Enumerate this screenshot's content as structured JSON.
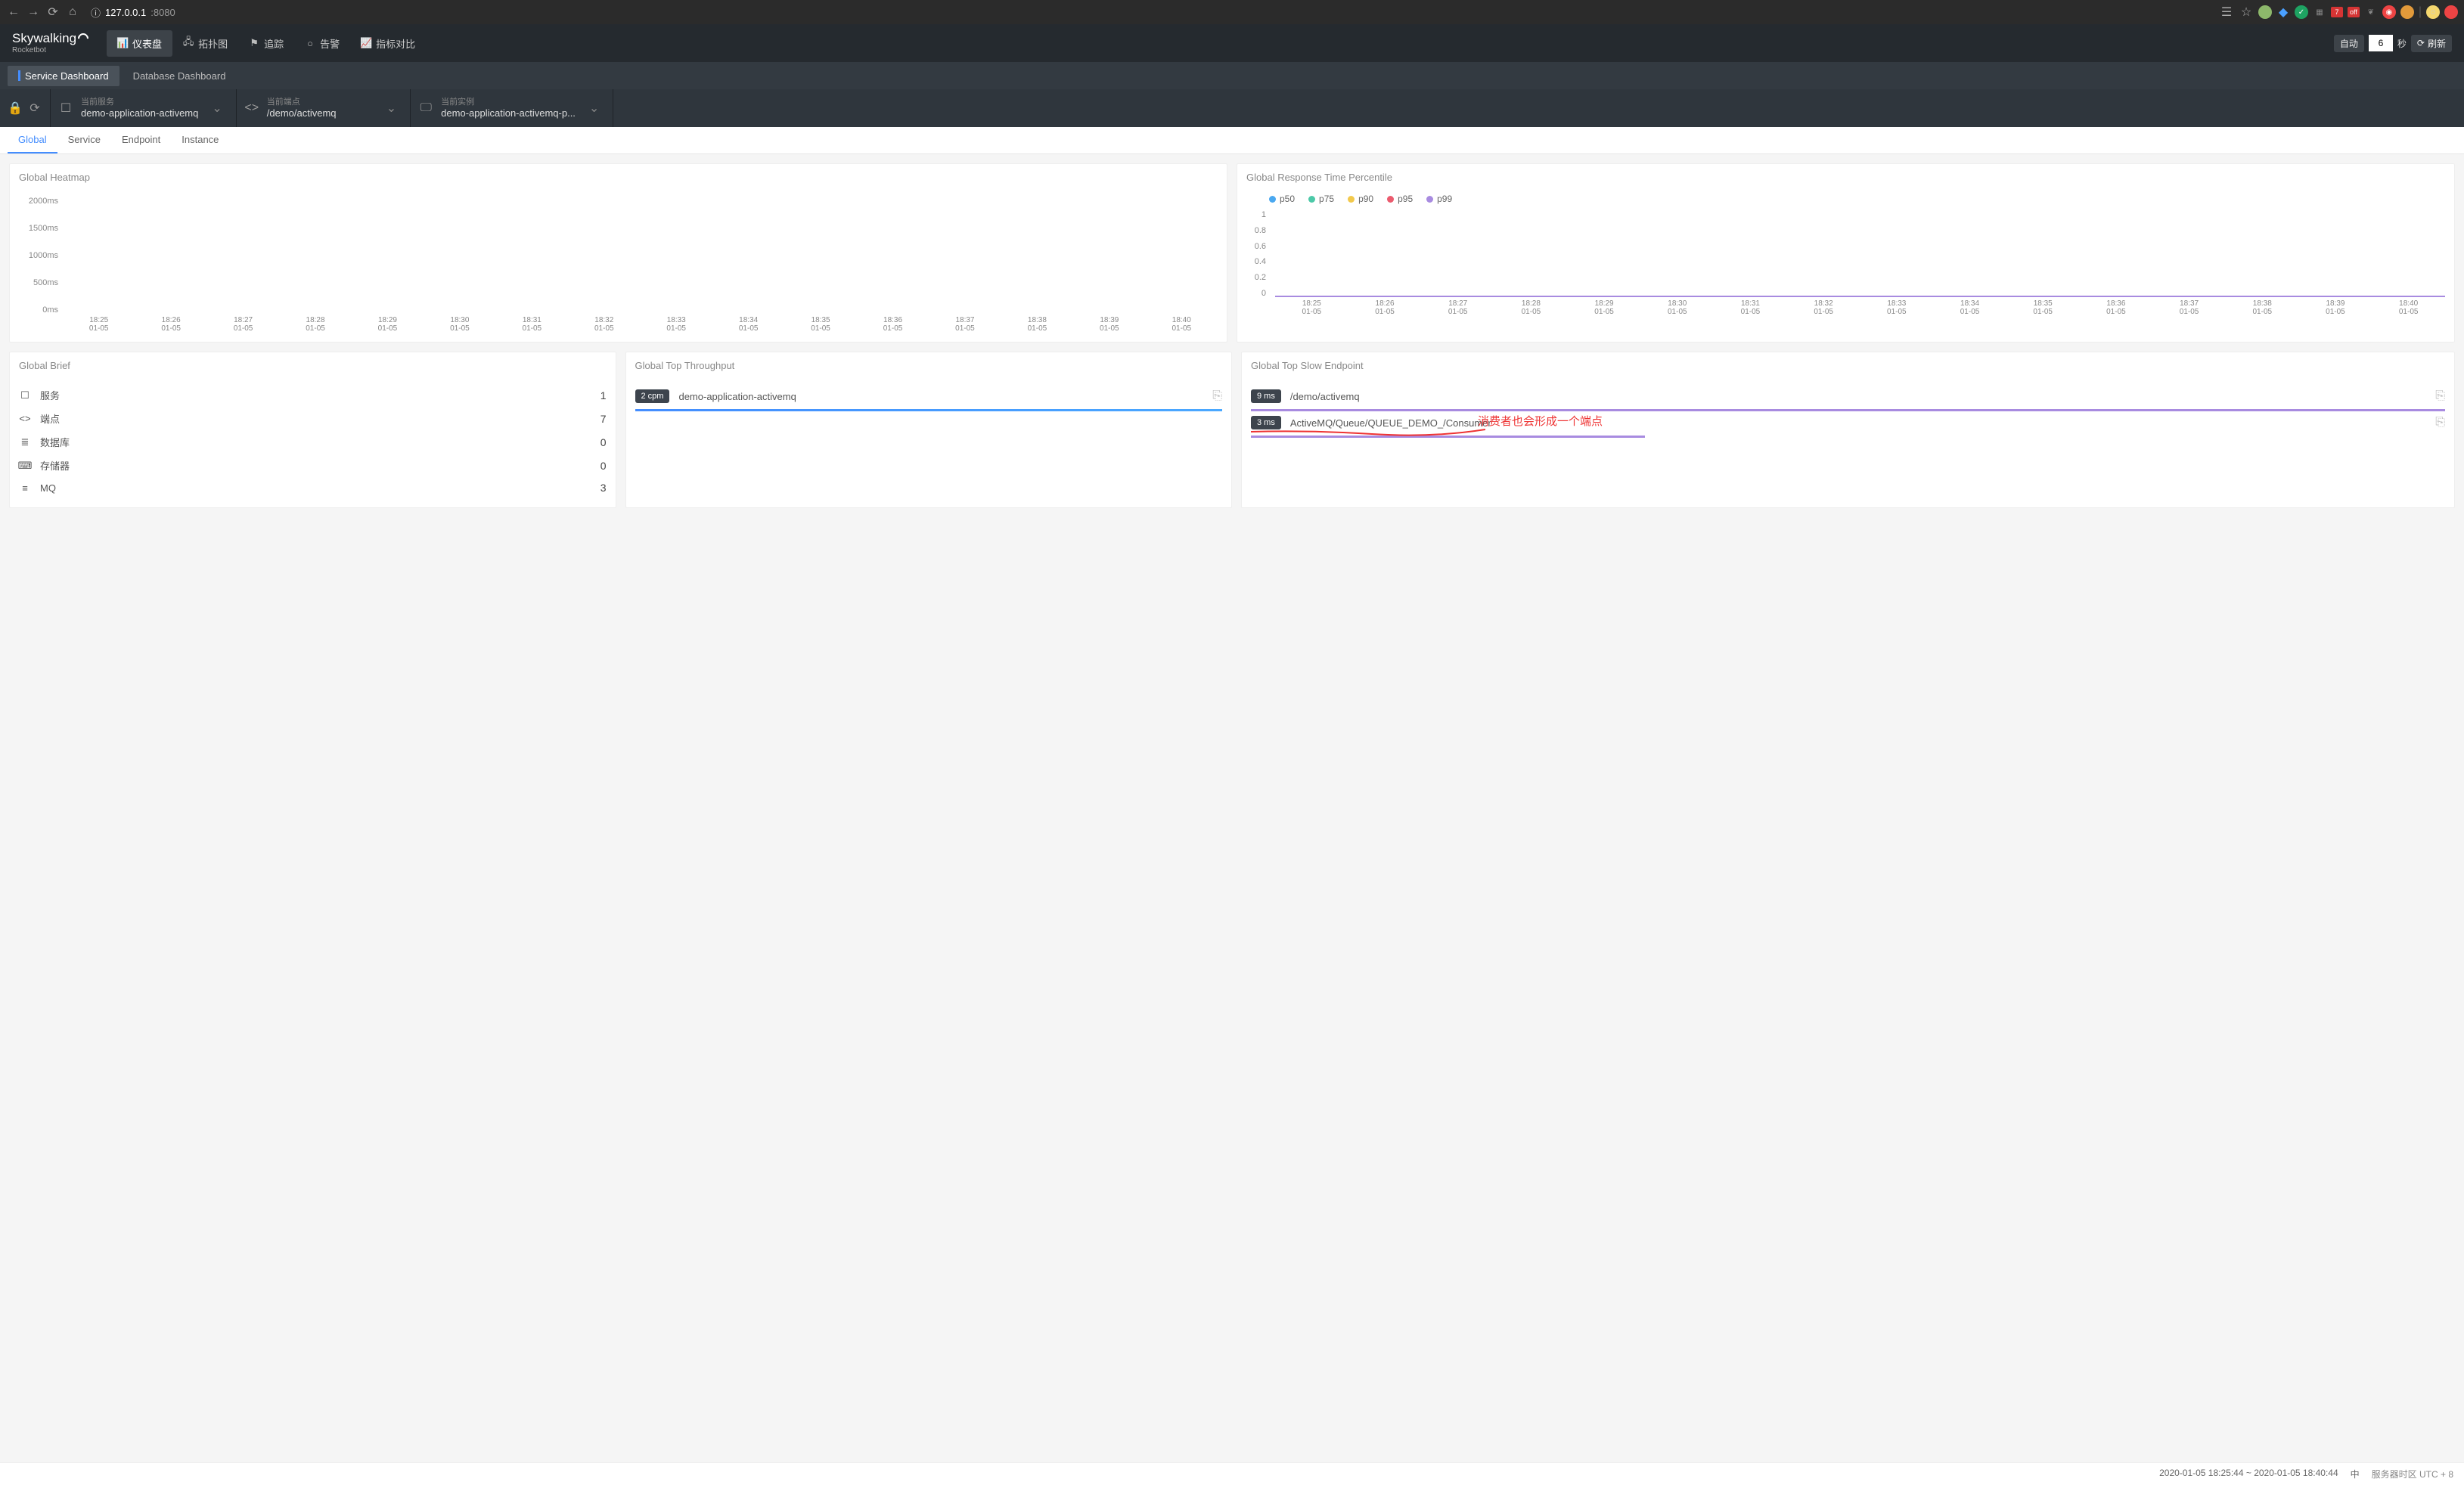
{
  "browser": {
    "url_host": "127.0.0.1",
    "url_port": ":8080",
    "badges": {
      "seven": "7",
      "off": "off"
    }
  },
  "header": {
    "logo_main": "Skywalking",
    "logo_sub": "Rocketbot",
    "nav": [
      {
        "label": "仪表盘"
      },
      {
        "label": "拓扑图"
      },
      {
        "label": "追踪"
      },
      {
        "label": "告警"
      },
      {
        "label": "指标对比"
      }
    ],
    "auto": "自动",
    "interval": "6",
    "unit": "秒",
    "refresh": "刷新"
  },
  "dashboard_tabs": {
    "service": "Service Dashboard",
    "database": "Database Dashboard"
  },
  "selectors": {
    "service": {
      "label": "当前服务",
      "value": "demo-application-activemq"
    },
    "endpoint": {
      "label": "当前端点",
      "value": "/demo/activemq"
    },
    "instance": {
      "label": "当前实例",
      "value": "demo-application-activemq-p..."
    }
  },
  "sub_tabs": [
    "Global",
    "Service",
    "Endpoint",
    "Instance"
  ],
  "x_ticks": [
    {
      "t": "18:25",
      "d": "01-05"
    },
    {
      "t": "18:26",
      "d": "01-05"
    },
    {
      "t": "18:27",
      "d": "01-05"
    },
    {
      "t": "18:28",
      "d": "01-05"
    },
    {
      "t": "18:29",
      "d": "01-05"
    },
    {
      "t": "18:30",
      "d": "01-05"
    },
    {
      "t": "18:31",
      "d": "01-05"
    },
    {
      "t": "18:32",
      "d": "01-05"
    },
    {
      "t": "18:33",
      "d": "01-05"
    },
    {
      "t": "18:34",
      "d": "01-05"
    },
    {
      "t": "18:35",
      "d": "01-05"
    },
    {
      "t": "18:36",
      "d": "01-05"
    },
    {
      "t": "18:37",
      "d": "01-05"
    },
    {
      "t": "18:38",
      "d": "01-05"
    },
    {
      "t": "18:39",
      "d": "01-05"
    },
    {
      "t": "18:40",
      "d": "01-05"
    }
  ],
  "heatmap": {
    "title": "Global Heatmap",
    "y_ticks": [
      "2000ms",
      "1500ms",
      "1000ms",
      "500ms",
      "0ms"
    ]
  },
  "chart_data": {
    "type": "line",
    "title": "Global Response Time Percentile",
    "ylabel": "",
    "ylim": [
      0,
      1
    ],
    "y_ticks": [
      "1",
      "0.8",
      "0.6",
      "0.4",
      "0.2",
      "0"
    ],
    "x_categories": [
      "18:25",
      "18:26",
      "18:27",
      "18:28",
      "18:29",
      "18:30",
      "18:31",
      "18:32",
      "18:33",
      "18:34",
      "18:35",
      "18:36",
      "18:37",
      "18:38",
      "18:39",
      "18:40"
    ],
    "x_date": "01-05",
    "series": [
      {
        "name": "p50",
        "color": "#4aa8f0",
        "values": [
          0,
          0,
          0,
          0,
          0,
          0,
          0,
          0,
          0,
          0,
          0,
          0,
          0,
          0,
          0,
          0
        ]
      },
      {
        "name": "p75",
        "color": "#4cc9a8",
        "values": [
          0,
          0,
          0,
          0,
          0,
          0,
          0,
          0,
          0,
          0,
          0,
          0,
          0,
          0,
          0,
          0
        ]
      },
      {
        "name": "p90",
        "color": "#f2c94c",
        "values": [
          0,
          0,
          0,
          0,
          0,
          0,
          0,
          0,
          0,
          0,
          0,
          0,
          0,
          0,
          0,
          0
        ]
      },
      {
        "name": "p95",
        "color": "#eb5b6e",
        "values": [
          0,
          0,
          0,
          0,
          0,
          0,
          0,
          0,
          0,
          0,
          0,
          0,
          0,
          0,
          0,
          0
        ]
      },
      {
        "name": "p99",
        "color": "#a88be0",
        "values": [
          0,
          0,
          0,
          0,
          0,
          0,
          0,
          0,
          0,
          0,
          0,
          0,
          0,
          0,
          0,
          0
        ]
      }
    ]
  },
  "brief": {
    "title": "Global Brief",
    "items": [
      {
        "label": "服务",
        "count": "1"
      },
      {
        "label": "端点",
        "count": "7"
      },
      {
        "label": "数据库",
        "count": "0"
      },
      {
        "label": "存储器",
        "count": "0"
      },
      {
        "label": "MQ",
        "count": "3"
      }
    ]
  },
  "throughput": {
    "title": "Global Top Throughput",
    "rows": [
      {
        "badge": "2 cpm",
        "name": "demo-application-activemq",
        "bar_pct": 100
      }
    ]
  },
  "slow": {
    "title": "Global Top Slow Endpoint",
    "rows": [
      {
        "badge": "9 ms",
        "name": "/demo/activemq",
        "bar_pct": 100
      },
      {
        "badge": "3 ms",
        "name": "ActiveMQ/Queue/QUEUE_DEMO_/Consumer",
        "bar_pct": 33
      }
    ],
    "annotation": "消费者也会形成一个端点"
  },
  "footer": {
    "range": "2020-01-05 18:25:44 ~ 2020-01-05 18:40:44",
    "lang": "中",
    "tz": "服务器时区 UTC + 8"
  }
}
